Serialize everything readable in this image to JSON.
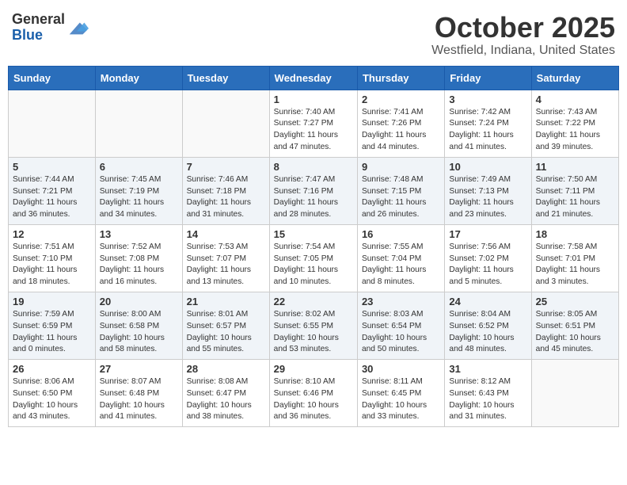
{
  "header": {
    "logo_line1": "General",
    "logo_line2": "Blue",
    "month": "October 2025",
    "location": "Westfield, Indiana, United States"
  },
  "weekdays": [
    "Sunday",
    "Monday",
    "Tuesday",
    "Wednesday",
    "Thursday",
    "Friday",
    "Saturday"
  ],
  "weeks": [
    [
      {
        "day": "",
        "sunrise": "",
        "sunset": "",
        "daylight": ""
      },
      {
        "day": "",
        "sunrise": "",
        "sunset": "",
        "daylight": ""
      },
      {
        "day": "",
        "sunrise": "",
        "sunset": "",
        "daylight": ""
      },
      {
        "day": "1",
        "sunrise": "Sunrise: 7:40 AM",
        "sunset": "Sunset: 7:27 PM",
        "daylight": "Daylight: 11 hours and 47 minutes."
      },
      {
        "day": "2",
        "sunrise": "Sunrise: 7:41 AM",
        "sunset": "Sunset: 7:26 PM",
        "daylight": "Daylight: 11 hours and 44 minutes."
      },
      {
        "day": "3",
        "sunrise": "Sunrise: 7:42 AM",
        "sunset": "Sunset: 7:24 PM",
        "daylight": "Daylight: 11 hours and 41 minutes."
      },
      {
        "day": "4",
        "sunrise": "Sunrise: 7:43 AM",
        "sunset": "Sunset: 7:22 PM",
        "daylight": "Daylight: 11 hours and 39 minutes."
      }
    ],
    [
      {
        "day": "5",
        "sunrise": "Sunrise: 7:44 AM",
        "sunset": "Sunset: 7:21 PM",
        "daylight": "Daylight: 11 hours and 36 minutes."
      },
      {
        "day": "6",
        "sunrise": "Sunrise: 7:45 AM",
        "sunset": "Sunset: 7:19 PM",
        "daylight": "Daylight: 11 hours and 34 minutes."
      },
      {
        "day": "7",
        "sunrise": "Sunrise: 7:46 AM",
        "sunset": "Sunset: 7:18 PM",
        "daylight": "Daylight: 11 hours and 31 minutes."
      },
      {
        "day": "8",
        "sunrise": "Sunrise: 7:47 AM",
        "sunset": "Sunset: 7:16 PM",
        "daylight": "Daylight: 11 hours and 28 minutes."
      },
      {
        "day": "9",
        "sunrise": "Sunrise: 7:48 AM",
        "sunset": "Sunset: 7:15 PM",
        "daylight": "Daylight: 11 hours and 26 minutes."
      },
      {
        "day": "10",
        "sunrise": "Sunrise: 7:49 AM",
        "sunset": "Sunset: 7:13 PM",
        "daylight": "Daylight: 11 hours and 23 minutes."
      },
      {
        "day": "11",
        "sunrise": "Sunrise: 7:50 AM",
        "sunset": "Sunset: 7:11 PM",
        "daylight": "Daylight: 11 hours and 21 minutes."
      }
    ],
    [
      {
        "day": "12",
        "sunrise": "Sunrise: 7:51 AM",
        "sunset": "Sunset: 7:10 PM",
        "daylight": "Daylight: 11 hours and 18 minutes."
      },
      {
        "day": "13",
        "sunrise": "Sunrise: 7:52 AM",
        "sunset": "Sunset: 7:08 PM",
        "daylight": "Daylight: 11 hours and 16 minutes."
      },
      {
        "day": "14",
        "sunrise": "Sunrise: 7:53 AM",
        "sunset": "Sunset: 7:07 PM",
        "daylight": "Daylight: 11 hours and 13 minutes."
      },
      {
        "day": "15",
        "sunrise": "Sunrise: 7:54 AM",
        "sunset": "Sunset: 7:05 PM",
        "daylight": "Daylight: 11 hours and 10 minutes."
      },
      {
        "day": "16",
        "sunrise": "Sunrise: 7:55 AM",
        "sunset": "Sunset: 7:04 PM",
        "daylight": "Daylight: 11 hours and 8 minutes."
      },
      {
        "day": "17",
        "sunrise": "Sunrise: 7:56 AM",
        "sunset": "Sunset: 7:02 PM",
        "daylight": "Daylight: 11 hours and 5 minutes."
      },
      {
        "day": "18",
        "sunrise": "Sunrise: 7:58 AM",
        "sunset": "Sunset: 7:01 PM",
        "daylight": "Daylight: 11 hours and 3 minutes."
      }
    ],
    [
      {
        "day": "19",
        "sunrise": "Sunrise: 7:59 AM",
        "sunset": "Sunset: 6:59 PM",
        "daylight": "Daylight: 11 hours and 0 minutes."
      },
      {
        "day": "20",
        "sunrise": "Sunrise: 8:00 AM",
        "sunset": "Sunset: 6:58 PM",
        "daylight": "Daylight: 10 hours and 58 minutes."
      },
      {
        "day": "21",
        "sunrise": "Sunrise: 8:01 AM",
        "sunset": "Sunset: 6:57 PM",
        "daylight": "Daylight: 10 hours and 55 minutes."
      },
      {
        "day": "22",
        "sunrise": "Sunrise: 8:02 AM",
        "sunset": "Sunset: 6:55 PM",
        "daylight": "Daylight: 10 hours and 53 minutes."
      },
      {
        "day": "23",
        "sunrise": "Sunrise: 8:03 AM",
        "sunset": "Sunset: 6:54 PM",
        "daylight": "Daylight: 10 hours and 50 minutes."
      },
      {
        "day": "24",
        "sunrise": "Sunrise: 8:04 AM",
        "sunset": "Sunset: 6:52 PM",
        "daylight": "Daylight: 10 hours and 48 minutes."
      },
      {
        "day": "25",
        "sunrise": "Sunrise: 8:05 AM",
        "sunset": "Sunset: 6:51 PM",
        "daylight": "Daylight: 10 hours and 45 minutes."
      }
    ],
    [
      {
        "day": "26",
        "sunrise": "Sunrise: 8:06 AM",
        "sunset": "Sunset: 6:50 PM",
        "daylight": "Daylight: 10 hours and 43 minutes."
      },
      {
        "day": "27",
        "sunrise": "Sunrise: 8:07 AM",
        "sunset": "Sunset: 6:48 PM",
        "daylight": "Daylight: 10 hours and 41 minutes."
      },
      {
        "day": "28",
        "sunrise": "Sunrise: 8:08 AM",
        "sunset": "Sunset: 6:47 PM",
        "daylight": "Daylight: 10 hours and 38 minutes."
      },
      {
        "day": "29",
        "sunrise": "Sunrise: 8:10 AM",
        "sunset": "Sunset: 6:46 PM",
        "daylight": "Daylight: 10 hours and 36 minutes."
      },
      {
        "day": "30",
        "sunrise": "Sunrise: 8:11 AM",
        "sunset": "Sunset: 6:45 PM",
        "daylight": "Daylight: 10 hours and 33 minutes."
      },
      {
        "day": "31",
        "sunrise": "Sunrise: 8:12 AM",
        "sunset": "Sunset: 6:43 PM",
        "daylight": "Daylight: 10 hours and 31 minutes."
      },
      {
        "day": "",
        "sunrise": "",
        "sunset": "",
        "daylight": ""
      }
    ]
  ]
}
